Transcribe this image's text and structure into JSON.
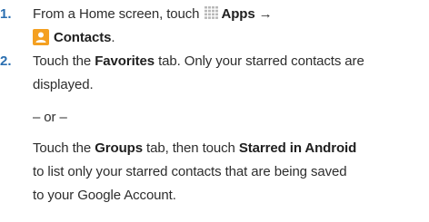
{
  "steps": [
    {
      "number": "1.",
      "text_before_icon": "From a Home screen, touch ",
      "apps_label": "Apps",
      "arrow": "→",
      "contacts_label": "Contacts",
      "after_contacts": "."
    },
    {
      "number": "2.",
      "line1_a": "Touch the ",
      "favorites_label": "Favorites",
      "line1_b": " tab. Only your starred contacts are",
      "line2": "displayed.",
      "or_text": "– or –",
      "line4_a": "Touch the ",
      "groups_label": "Groups",
      "line4_b": " tab, then touch ",
      "starred_label": "Starred in Android",
      "line5": "to list only your starred contacts that are being saved",
      "line6": "to your Google Account."
    }
  ],
  "icons": {
    "apps": "apps-grid-icon",
    "contacts": "contacts-person-icon"
  },
  "colors": {
    "step_number": "#2a6eb0",
    "contacts_icon": "#f4a021",
    "apps_icon": "#b9b9b9"
  }
}
